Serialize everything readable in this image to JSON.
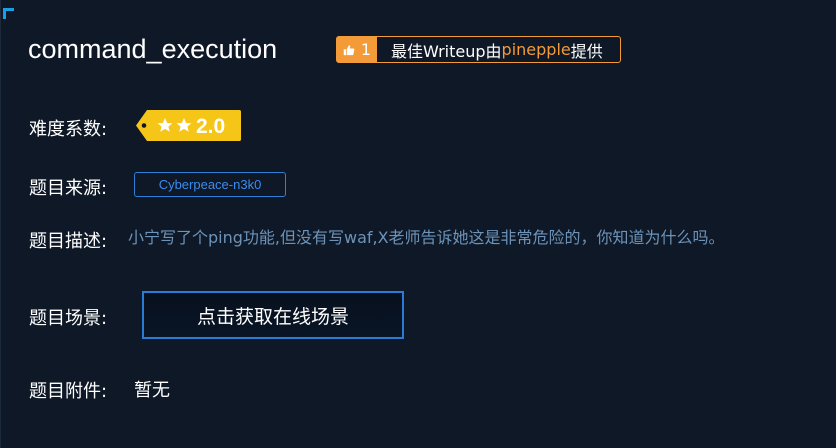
{
  "challenge": {
    "title": "command_execution",
    "writeup": {
      "likes": "1",
      "prefix": "最佳Writeup由",
      "user": "pinepple",
      "suffix": "提供"
    },
    "difficulty": {
      "label": "难度系数:",
      "value": "2.0",
      "stars": 2
    },
    "source": {
      "label": "题目来源:",
      "value": "Cyberpeace-n3k0"
    },
    "description": {
      "label": "题目描述:",
      "value": "小宁写了个ping功能,但没有写waf,X老师告诉她这是非常危险的，你知道为什么吗。"
    },
    "scene": {
      "label": "题目场景:",
      "button": "点击获取在线场景"
    },
    "attachment": {
      "label": "题目附件:",
      "value": "暂无"
    }
  },
  "colors": {
    "background": "#0e1826",
    "accent_orange": "#f29b38",
    "accent_blue": "#2a7bd5",
    "badge_yellow": "#f5c518",
    "description_text": "#6d93b9"
  },
  "icons": [
    "thumbs-up-icon",
    "star-icon"
  ]
}
